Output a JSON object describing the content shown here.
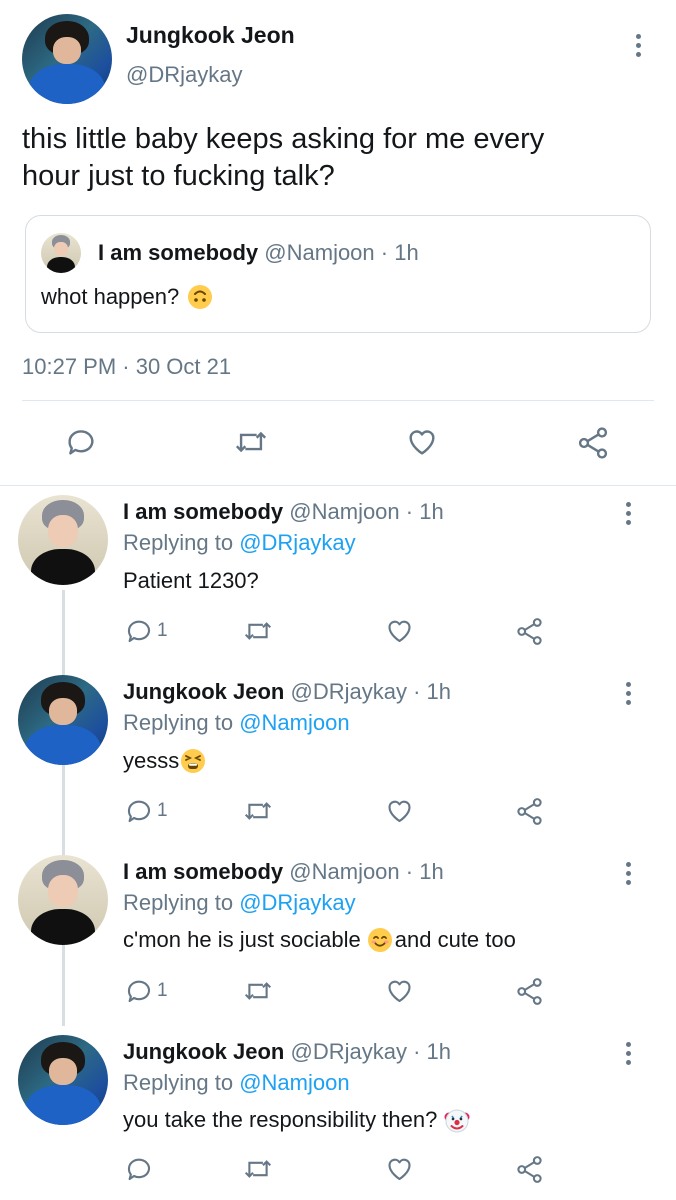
{
  "main_tweet": {
    "author_name": "Jungkook Jeon",
    "author_handle": "@DRjaykay",
    "text_line1": "this little baby keeps asking for me every",
    "text_line2": "hour just to fucking talk?",
    "timestamp": "10:27 PM · 30 Oct 21",
    "quote": {
      "author_name": "I am somebody",
      "author_handle": "@Namjoon",
      "time": "· 1h",
      "text": "whot happen?"
    }
  },
  "replies": [
    {
      "author_name": "I am somebody",
      "author_handle": "@Namjoon",
      "time": "· 1h",
      "replying_prefix": "Replying to",
      "replying_to": "@DRjaykay",
      "text": "Patient 1230?",
      "reply_count": "1"
    },
    {
      "author_name": "Jungkook Jeon",
      "author_handle": "@DRjaykay",
      "time": "· 1h",
      "replying_prefix": "Replying to",
      "replying_to": "@Namjoon",
      "text": "yesss",
      "reply_count": "1"
    },
    {
      "author_name": "I am somebody",
      "author_handle": "@Namjoon",
      "time": "· 1h",
      "replying_prefix": "Replying to",
      "replying_to": "@DRjaykay",
      "text_part1": "c'mon he is just sociable",
      "text_part2": "and cute too",
      "reply_count": "1"
    },
    {
      "author_name": "Jungkook Jeon",
      "author_handle": "@DRjaykay",
      "time": "· 1h",
      "replying_prefix": "Replying to",
      "replying_to": "@Namjoon",
      "text": "you take the responsibility then?",
      "reply_count": ""
    }
  ],
  "icons": {
    "reply": "reply-icon",
    "retweet": "retweet-icon",
    "like": "like-icon",
    "share": "share-icon",
    "more": "more-icon"
  },
  "colors": {
    "text": "#14171a",
    "secondary": "#657786",
    "link": "#1da1f2",
    "border": "#e1e8ed",
    "thread_line": "#d9dee2"
  }
}
